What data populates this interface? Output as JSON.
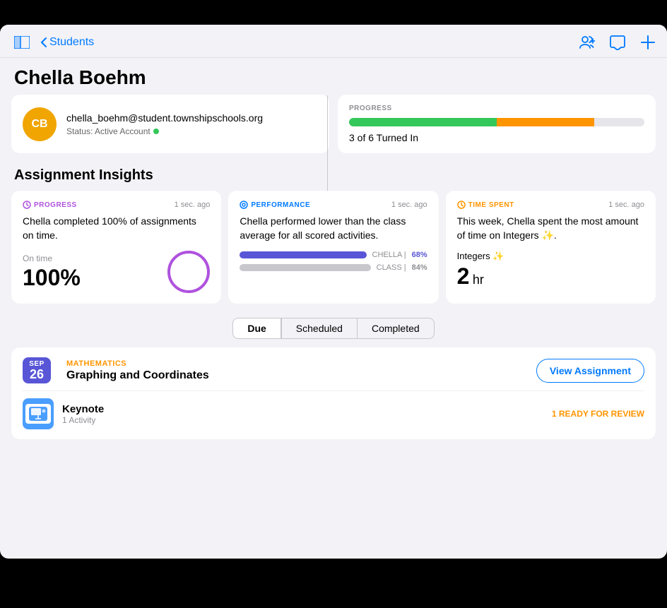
{
  "header": {
    "back_label": "Students",
    "page_title": "Chella Boehm"
  },
  "profile": {
    "initials": "CB",
    "email": "chella_boehm@student.townshipschools.org",
    "status_label": "Status: Active Account"
  },
  "progress_card": {
    "label": "PROGRESS",
    "green_pct": 50,
    "orange_pct": 33,
    "summary": "3 of 6 Turned In"
  },
  "insights_title": "Assignment Insights",
  "insights": [
    {
      "badge": "PROGRESS",
      "badge_type": "progress",
      "badge_icon": "↻",
      "time": "1 sec. ago",
      "description": "Chella completed 100% of assignments on time.",
      "stat_label": "On time",
      "stat_value": "100",
      "stat_unit": "%"
    },
    {
      "badge": "PERFORMANCE",
      "badge_type": "performance",
      "badge_icon": "◎",
      "time": "1 sec. ago",
      "description": "Chella performed lower than the class average for all scored activities.",
      "chella_pct": "68%",
      "class_pct": "84%"
    },
    {
      "badge": "TIME SPENT",
      "badge_type": "time",
      "badge_icon": "⏱",
      "time": "1 sec. ago",
      "description": "This week, Chella spent the most amount of time on Integers ✨.",
      "topic": "Integers ✨",
      "time_value": "2",
      "time_unit": "hr"
    }
  ],
  "tabs": [
    {
      "label": "Due",
      "active": true
    },
    {
      "label": "Scheduled",
      "active": false
    },
    {
      "label": "Completed",
      "active": false
    }
  ],
  "assignment": {
    "date_month": "SEP",
    "date_day": "26",
    "subject": "MATHEMATICS",
    "name": "Graphing and Coordinates",
    "view_btn": "View Assignment",
    "activity_name": "Keynote",
    "activity_count": "1 Activity",
    "activity_status": "1 READY FOR REVIEW"
  }
}
